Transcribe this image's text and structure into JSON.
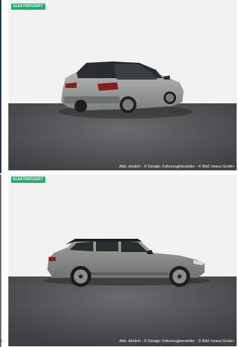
{
  "gallery": {
    "images": [
      {
        "badge": "ELEKTRIFIZIERT",
        "caption": "Abb. ähnlich - © Design: Fahrzeughersteller - © Bild: Imaca GmbH",
        "view": "rear-three-quarter"
      },
      {
        "badge": "ELEKTRIFIZIERT",
        "caption": "Abb. ähnlich - © Design: Fahrzeughersteller - © Bild: Imaca GmbH",
        "view": "side-profile"
      }
    ],
    "left_edge_text": "9"
  },
  "colors": {
    "badge_green": "#1fb071",
    "car_gray": "#8a8f8c",
    "floor": "#545556",
    "backdrop": "#f1f1f1"
  }
}
